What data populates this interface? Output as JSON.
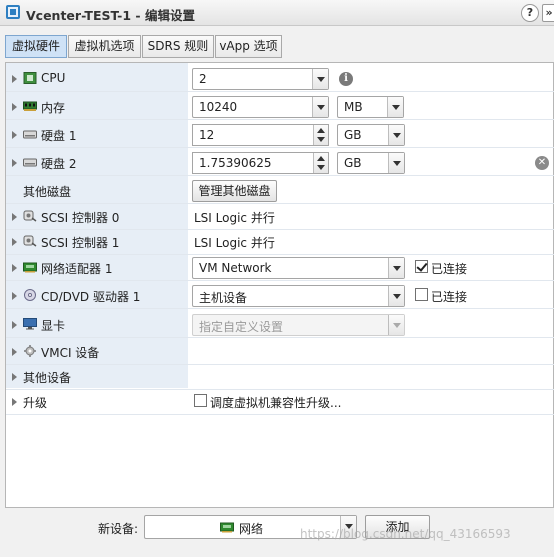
{
  "window": {
    "title": "Vcenter-TEST-1 - 编辑设置",
    "help_label": "?",
    "expand_label": "»"
  },
  "tabs": [
    {
      "label": "虚拟硬件",
      "active": true
    },
    {
      "label": "虚拟机选项"
    },
    {
      "label": "SDRS 规则"
    },
    {
      "label": "vApp 选项"
    }
  ],
  "rows": {
    "cpu": {
      "label": "CPU",
      "value": "2",
      "icon": "cpu-chip-icon",
      "info_icon": "info-icon"
    },
    "memory": {
      "label": "内存",
      "value": "10240",
      "unit": "MB",
      "icon": "memory-module-icon"
    },
    "disk1": {
      "label": "硬盘 1",
      "value": "12",
      "unit": "GB",
      "icon": "hard-disk-icon"
    },
    "disk2": {
      "label": "硬盘 2",
      "value": "1.75390625",
      "unit": "GB",
      "icon": "hard-disk-icon",
      "remove_icon": "remove-icon"
    },
    "other_disks": {
      "label": "其他磁盘",
      "button": "管理其他磁盘"
    },
    "scsi0": {
      "label": "SCSI 控制器 0",
      "value": "LSI Logic 并行",
      "icon": "scsi-controller-icon"
    },
    "scsi1": {
      "label": "SCSI 控制器 1",
      "value": "LSI Logic 并行",
      "icon": "scsi-controller-icon"
    },
    "nic1": {
      "label": "网络适配器 1",
      "value": "VM Network",
      "connected_label": "已连接",
      "connected": true,
      "icon": "network-adapter-icon"
    },
    "cdrom1": {
      "label": "CD/DVD 驱动器 1",
      "value": "主机设备",
      "connected_label": "已连接",
      "connected": false,
      "icon": "cd-dvd-icon"
    },
    "video": {
      "label": "显卡",
      "value": "指定自定义设置",
      "icon": "monitor-icon"
    },
    "vmci": {
      "label": "VMCI 设备",
      "icon": "gear-icon"
    },
    "other_devices": {
      "label": "其他设备"
    },
    "upgrade": {
      "label": "升级",
      "checkbox_label": "调度虚拟机兼容性升级...",
      "checked": false
    }
  },
  "footer": {
    "new_device_label": "新设备:",
    "new_device_value": "网络",
    "add_button": "添加",
    "watermark": "https://blog.csdn.net/qq_43166593"
  }
}
